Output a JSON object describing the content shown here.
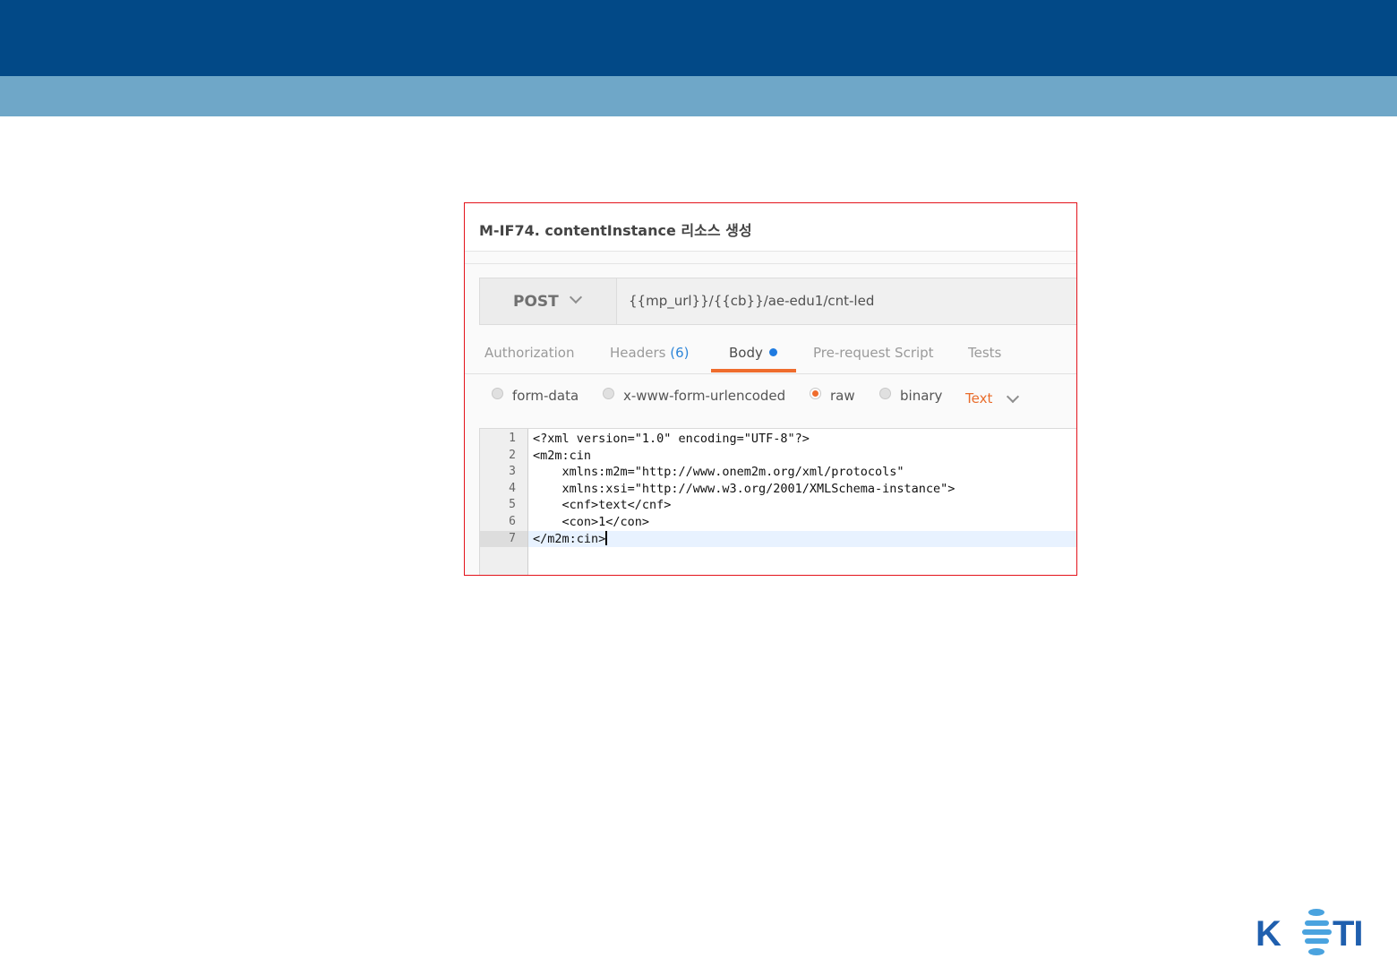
{
  "panel": {
    "title": "M-IF74. contentInstance 리소스 생성"
  },
  "request": {
    "method": "POST",
    "url": "{{mp_url}}/{{cb}}/ae-edu1/cnt-led"
  },
  "tabs": [
    {
      "label": "Authorization"
    },
    {
      "label": "Headers",
      "count": "(6)"
    },
    {
      "label": "Body",
      "active": true
    },
    {
      "label": "Pre-request Script"
    },
    {
      "label": "Tests"
    }
  ],
  "body_options": {
    "items": [
      {
        "label": "form-data",
        "checked": false
      },
      {
        "label": "x-www-form-urlencoded",
        "checked": false
      },
      {
        "label": "raw",
        "checked": true
      },
      {
        "label": "binary",
        "checked": false
      }
    ],
    "content_type": "Text"
  },
  "editor": {
    "line_numbers": [
      "1",
      "2",
      "3",
      "4",
      "5",
      "6",
      "7"
    ],
    "lines": [
      "<?xml version=\"1.0\" encoding=\"UTF-8\"?>",
      "<m2m:cin",
      "    xmlns:m2m=\"http://www.onem2m.org/xml/protocols\"",
      "    xmlns:xsi=\"http://www.w3.org/2001/XMLSchema-instance\">",
      "    <cnf>text</cnf>",
      "    <con>1</con>",
      "</m2m:cin>"
    ],
    "current_line": 7
  },
  "logo": {
    "text": "KETI",
    "color": "#1f5fae",
    "accent": "#4aa3df"
  },
  "colors": {
    "header_dark": "#024987",
    "header_light": "#6fa7c8",
    "highlight_border": "#e3131b",
    "active_tab": "#ef6c2d"
  }
}
